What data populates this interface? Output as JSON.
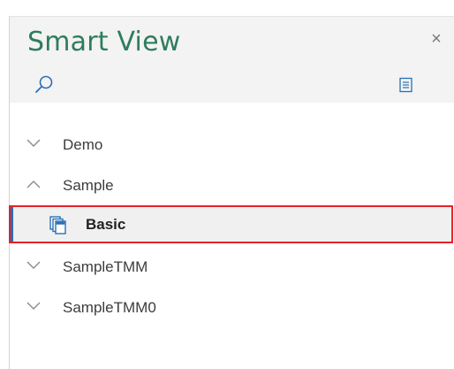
{
  "panel": {
    "title": "Smart View",
    "close_label": "×"
  },
  "toolbar": {
    "search_icon": "search-icon",
    "menu_icon": "list-menu-icon"
  },
  "tree": {
    "items": [
      {
        "label": "Demo",
        "state": "collapsed"
      },
      {
        "label": "Sample",
        "state": "expanded"
      },
      {
        "label": "Basic",
        "state": "selected-child",
        "icon": "cube-document-icon"
      },
      {
        "label": "SampleTMM",
        "state": "collapsed"
      },
      {
        "label": "SampleTMM0",
        "state": "collapsed"
      }
    ]
  },
  "colors": {
    "title": "#2e7d5b",
    "selection_border": "#e8212a",
    "selection_accent": "#2b6fb6",
    "icon_blue": "#2b6fb6"
  }
}
